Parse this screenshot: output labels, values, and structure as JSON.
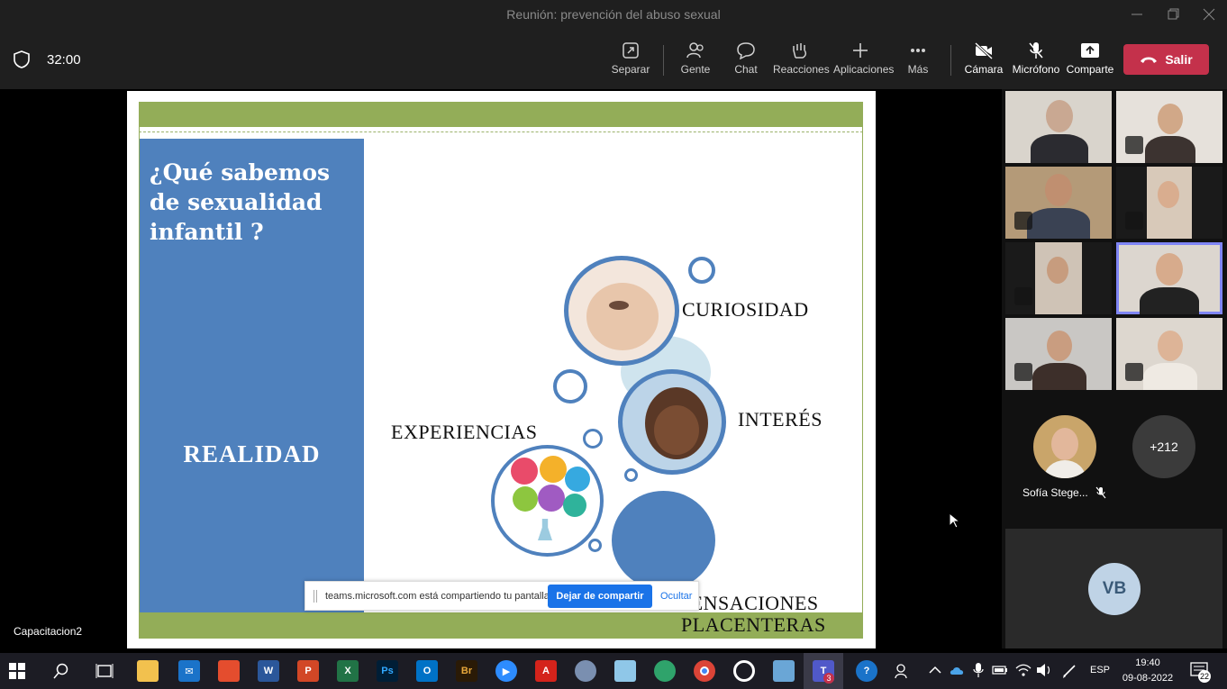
{
  "window": {
    "title": "Reunión: prevención del abuso sexual"
  },
  "toolbar": {
    "timer": "32:00",
    "buttons": {
      "separar": "Separar",
      "gente": "Gente",
      "chat": "Chat",
      "reacciones": "Reacciones",
      "aplicaciones": "Aplicaciones",
      "mas": "Más",
      "camara": "Cámara",
      "microfono": "Micrófono",
      "comparte": "Comparte"
    },
    "leave_label": "Salir",
    "leave_color": "#c4314b"
  },
  "slide": {
    "title": "¿Qué sabemos de sexualidad infantil ?",
    "left_label": "REALIDAD",
    "labels": {
      "curiosidad": "CURIOSIDAD",
      "interes": "INTERÉS",
      "experiencias": "EXPERIENCIAS",
      "sensaciones": "SENSACIONES",
      "placenteras": "PLACENTERAS"
    },
    "colors": {
      "green": "#93ad58",
      "blue": "#4f81bd"
    }
  },
  "share_banner": {
    "message": "teams.microsoft.com está compartiendo tu pantalla.",
    "stop_label": "Dejar de compartir",
    "hide_label": "Ocultar"
  },
  "presenter_name": "Capacitacion2",
  "participants": {
    "sofia_name": "Sofía Stege...",
    "more_count": "+212",
    "vb_initials": "VB"
  },
  "taskbar": {
    "lang": "ESP",
    "time": "19:40",
    "date": "09-08-2022",
    "notifications": "22",
    "teams_badge": "3"
  }
}
